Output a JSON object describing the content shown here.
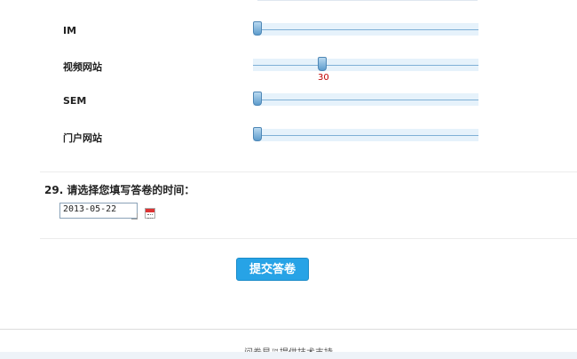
{
  "sliders": [
    {
      "label": "IM",
      "value": 0
    },
    {
      "label": "视频网站",
      "value": 30,
      "value_text": "30"
    },
    {
      "label": "SEM",
      "value": 0
    },
    {
      "label": "门户网站",
      "value": 0
    }
  ],
  "question": {
    "title": "29. 请选择您填写答卷的时间：",
    "date_value": "2013-05-22"
  },
  "submit": {
    "label": "提交答卷"
  },
  "footer": {
    "text": "问卷星™提供技术支持"
  },
  "colors": {
    "accent": "#27a3e6",
    "value_text": "#c00000",
    "track": "#e6f2fb"
  },
  "icons": {
    "calendar": "calendar-icon"
  }
}
